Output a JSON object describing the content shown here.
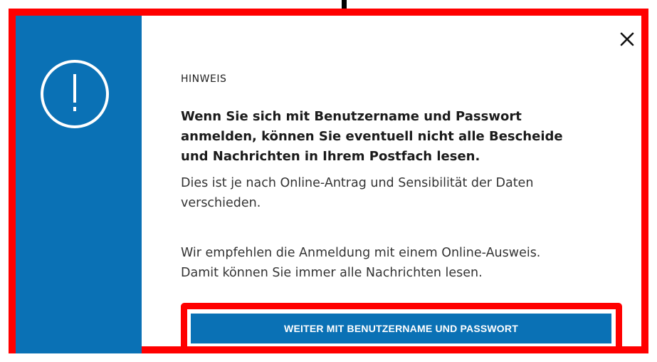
{
  "dialog": {
    "close_label": "✕",
    "kicker": "HINWEIS",
    "lead_lines": [
      "Wenn Sie sich mit Benutzername und Passwort",
      "anmelden, können Sie eventuell nicht alle Bescheide",
      "und Nachrichten in Ihrem Postfach lesen."
    ],
    "body1_lines": [
      "Dies ist je nach Online-Antrag und Sensibilität der Daten",
      "verschieden."
    ],
    "body2_lines": [
      "Wir empfehlen die Anmeldung mit einem Online-Ausweis.",
      "Damit können Sie immer alle Nachrichten lesen."
    ],
    "primary_button_label": "WEITER MIT BENUTZERNAME UND PASSWORT"
  },
  "icons": {
    "alert": "exclamation-circle-icon",
    "close": "close-icon"
  },
  "colors": {
    "accent": "#0a71b5",
    "highlight": "#ff0000",
    "text": "#333333"
  }
}
